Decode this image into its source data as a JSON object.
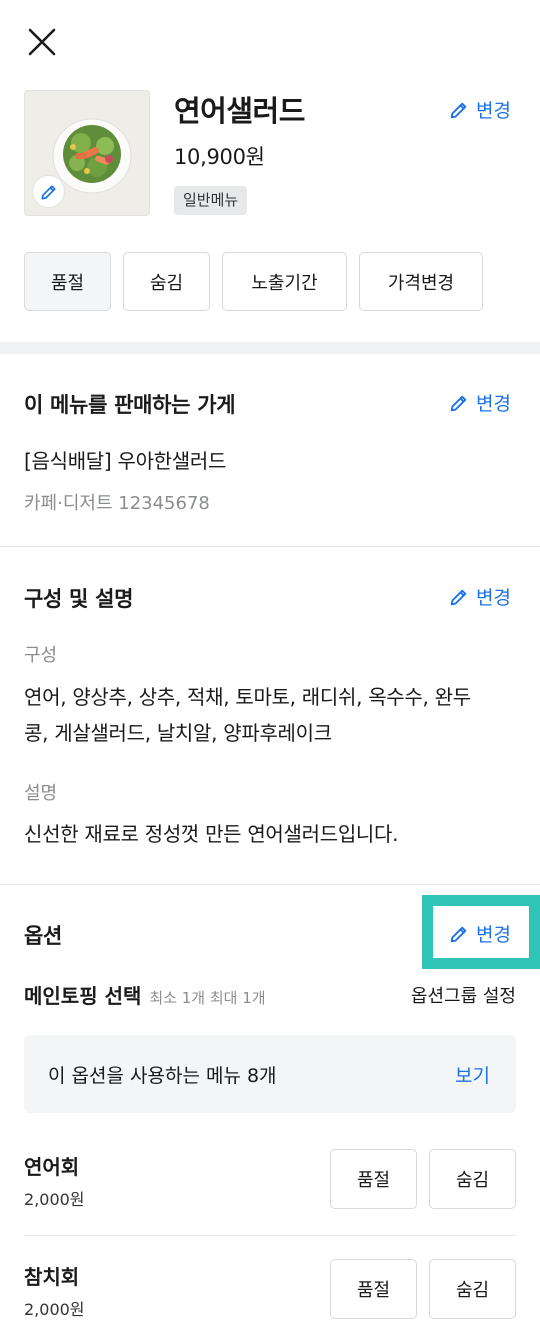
{
  "header": {
    "close_icon": "close-icon"
  },
  "menu": {
    "name": "연어샐러드",
    "price": "10,900원",
    "type_badge": "일반메뉴",
    "edit_label": "변경",
    "image_edit_icon": "pencil-icon"
  },
  "actions": [
    {
      "label": "품절"
    },
    {
      "label": "숨김"
    },
    {
      "label": "노출기간"
    },
    {
      "label": "가격변경"
    }
  ],
  "store": {
    "title": "이 메뉴를 판매하는 가게",
    "edit_label": "변경",
    "name": "[음식배달] 우아한샐러드",
    "category_id": "카페·디저트 12345678"
  },
  "composition": {
    "title": "구성 및 설명",
    "edit_label": "변경",
    "composition_label": "구성",
    "composition_line1": "연어, 양상추, 상추, 적채, 토마토, 래디쉬, 옥수수, 완두",
    "composition_line2": "콩, 게살샐러드, 날치알, 양파후레이크",
    "description_label": "설명",
    "description": "신선한 재료로 정성껏 만든 연어샐러드입니다."
  },
  "options": {
    "title": "옵션",
    "edit_label": "변경",
    "group_name": "메인토핑 선택",
    "group_limit": "최소 1개 최대 1개",
    "group_settings": "옵션그룹 설정",
    "usage_text": "이 옵션을 사용하는 메뉴 8개",
    "usage_link": "보기",
    "items": [
      {
        "name": "연어회",
        "price": "2,000원",
        "soldout_label": "품절",
        "hide_label": "숨김"
      },
      {
        "name": "참치회",
        "price": "2,000원",
        "soldout_label": "품절",
        "hide_label": "숨김"
      }
    ]
  },
  "colors": {
    "accent": "#1a73e8",
    "highlight": "#2ec4b6"
  }
}
